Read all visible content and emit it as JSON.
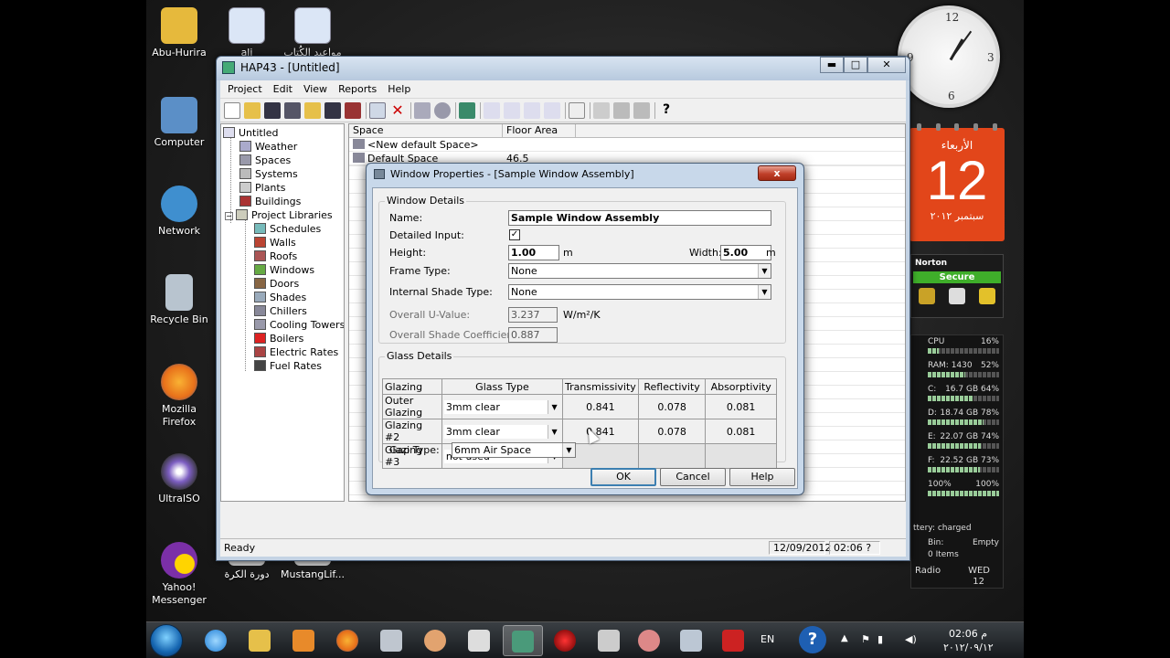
{
  "desktop": {
    "icons": [
      {
        "label": "Abu-Hurira",
        "icon": "folder-icon",
        "color": "#e6b93c"
      },
      {
        "label": "ali",
        "icon": "word-document-icon",
        "color": "#dbe6f6"
      },
      {
        "label": "مواعيد الكُتاب",
        "icon": "word-document-icon",
        "color": "#dbe6f6"
      },
      {
        "label": "Computer",
        "icon": "computer-icon",
        "color": "#5b8fc7"
      },
      {
        "label": "Network",
        "icon": "network-icon",
        "color": "#3f8fcf"
      },
      {
        "label": "Recycle Bin",
        "icon": "recycle-bin-icon",
        "color": "#b8c4cf"
      },
      {
        "label": "Mozilla Firefox",
        "icon": "firefox-icon",
        "color": "#e8701a"
      },
      {
        "label": "UltraISO",
        "icon": "ultraiso-icon",
        "color": "#7d5fc2"
      },
      {
        "label": "Yahoo! Messenger",
        "icon": "yahoo-messenger-icon",
        "color": "#7b2fa7"
      },
      {
        "label": "دورة الكرة",
        "icon": "document-icon",
        "color": "#c9c9c9"
      },
      {
        "label": "MustangLif...",
        "icon": "document-icon",
        "color": "#c9c9c9"
      }
    ]
  },
  "gadgets": {
    "calendar": {
      "weekday": "الأربعاء",
      "day": "12",
      "month": "سبتمبر ٢٠١٢"
    },
    "norton": {
      "brand": "Norton",
      "status": "Secure"
    },
    "meter": {
      "rows": [
        {
          "label": "CPU",
          "value": "16%",
          "pct": 16
        },
        {
          "label": "RAM: 1430",
          "value": "52%",
          "pct": 52
        },
        {
          "label": "C:",
          "value": "16.7 GB 64%",
          "pct": 64
        },
        {
          "label": "D:",
          "value": "18.74 GB 78%",
          "pct": 78
        },
        {
          "label": "E:",
          "value": "22.07 GB 74%",
          "pct": 74
        },
        {
          "label": "F:",
          "value": "22.52 GB 73%",
          "pct": 73
        },
        {
          "label": "100%",
          "value": "100%",
          "pct": 100
        }
      ],
      "battery": "ttery: charged",
      "bin_label": "Bin:",
      "bin_items": "0 Items",
      "bin_state": "Empty",
      "radio": "Radio",
      "day_name": "WED",
      "day_num": "12"
    }
  },
  "taskbar": {
    "language": "EN",
    "time": "02:06 م",
    "date": "٢٠١٢/٠٩/١٢"
  },
  "hap": {
    "title": "HAP43 - [Untitled]",
    "menu": [
      "Project",
      "Edit",
      "View",
      "Reports",
      "Help"
    ],
    "tree": {
      "root": "Untitled",
      "items": [
        "Weather",
        "Spaces",
        "Systems",
        "Plants",
        "Buildings"
      ],
      "library": "Project Libraries",
      "library_items": [
        "Schedules",
        "Walls",
        "Roofs",
        "Windows",
        "Doors",
        "Shades",
        "Chillers",
        "Cooling Towers",
        "Boilers",
        "Electric Rates",
        "Fuel Rates"
      ]
    },
    "list": {
      "columns": [
        "Space",
        "Floor Area"
      ],
      "rows": [
        {
          "space": "<New default Space>",
          "area": ""
        },
        {
          "space": "Default Space",
          "area": "46.5"
        }
      ]
    },
    "status": {
      "text": "Ready",
      "date": "12/09/2012",
      "time": "02:06 ?"
    }
  },
  "dialog": {
    "title": "Window Properties - [Sample Window Assembly]",
    "close": "x",
    "window_details": "Window Details",
    "name_label": "Name:",
    "name_value": "Sample Window Assembly",
    "detailed_label": "Detailed Input:",
    "detailed_checked": "✓",
    "height_label": "Height:",
    "height_value": "1.00",
    "height_unit": "m",
    "width_label": "Width:",
    "width_value": "5.00",
    "width_unit": "m",
    "frame_label": "Frame Type:",
    "frame_value": "None",
    "shade_label": "Internal Shade Type:",
    "shade_value": "None",
    "u_label": "Overall U-Value:",
    "u_value": "3.237",
    "u_unit": "W/m²/K",
    "sc_label": "Overall Shade Coefficient:",
    "sc_value": "0.887",
    "glass_details": "Glass Details",
    "glass_columns": [
      "Glazing",
      "Glass Type",
      "Transmissivity",
      "Reflectivity",
      "Absorptivity"
    ],
    "glass_rows": [
      {
        "glazing": "Outer Glazing",
        "type": "3mm clear",
        "trans": "0.841",
        "refl": "0.078",
        "abs": "0.081"
      },
      {
        "glazing": "Glazing #2",
        "type": "3mm clear",
        "trans": "0.841",
        "refl": "0.078",
        "abs": "0.081"
      },
      {
        "glazing": "Glazing #3",
        "type": "not used",
        "trans": "",
        "refl": "",
        "abs": ""
      }
    ],
    "gap_label": "Gap Type:",
    "gap_value": "6mm Air Space",
    "ok": "OK",
    "cancel": "Cancel",
    "help": "Help"
  }
}
